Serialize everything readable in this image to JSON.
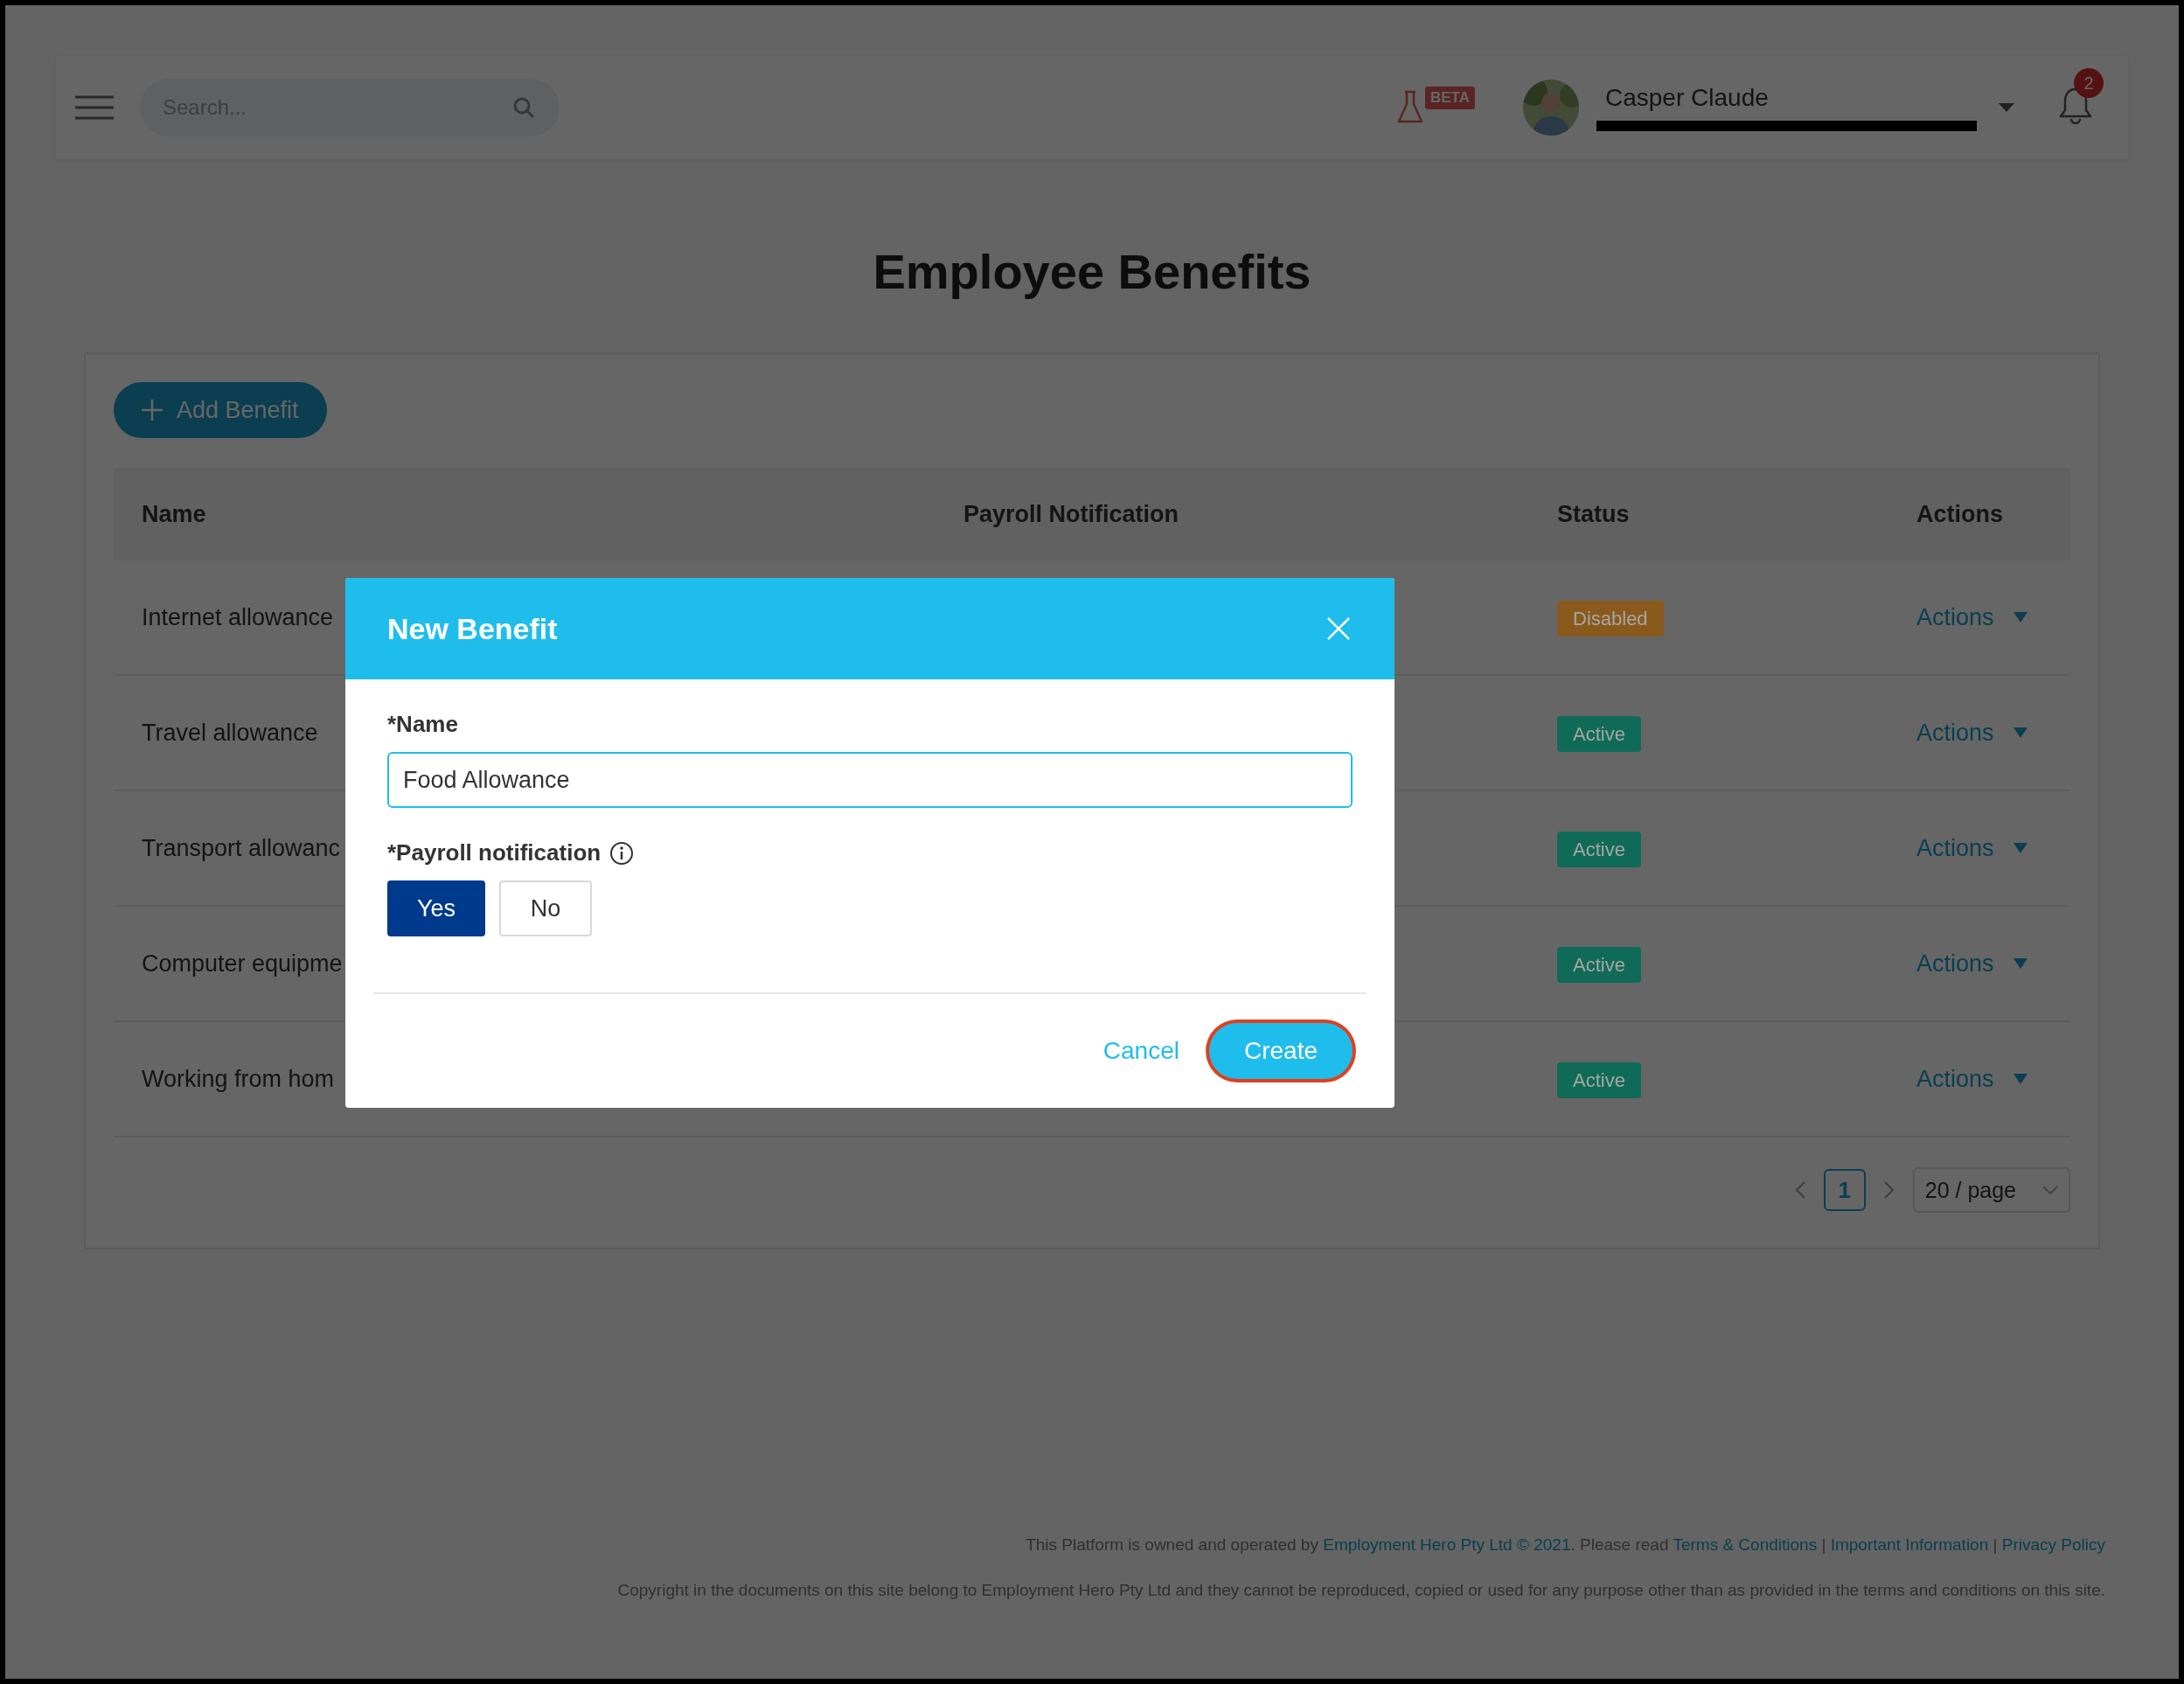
{
  "header": {
    "search": {
      "placeholder": "Search..."
    },
    "beta_badge": "BETA",
    "user": {
      "name": "Casper Claude"
    },
    "notifications": {
      "count": "2"
    }
  },
  "page_title": "Employee Benefits",
  "add_button": "Add Benefit",
  "table": {
    "columns": [
      "Name",
      "Payroll Notification",
      "Status",
      "Actions"
    ],
    "rows": [
      {
        "name": "Internet allowance",
        "status": {
          "label": "Disabled",
          "color": "#8a5a1c"
        },
        "actions": "Actions"
      },
      {
        "name": "Travel allowance",
        "status": {
          "label": "Active",
          "color": "#0f6b57"
        },
        "actions": "Actions"
      },
      {
        "name": "Transport allowanc",
        "status": {
          "label": "Active",
          "color": "#0f6b57"
        },
        "actions": "Actions"
      },
      {
        "name": "Computer equipme",
        "status": {
          "label": "Active",
          "color": "#0f6b57"
        },
        "actions": "Actions"
      },
      {
        "name": "Working from hom",
        "status": {
          "label": "Active",
          "color": "#0f6b57"
        },
        "actions": "Actions"
      }
    ]
  },
  "pagination": {
    "pages": [
      {
        "label": "1",
        "selected": true
      }
    ],
    "page_size": "20 / page"
  },
  "modal": {
    "title": "New Benefit",
    "name_field": {
      "label": "*Name",
      "value": "Food Allowance"
    },
    "payroll": {
      "label": "*Payroll notification",
      "options": [
        {
          "label": "Yes",
          "selected": true
        },
        {
          "label": "No",
          "selected": false
        }
      ]
    },
    "buttons": [
      {
        "label": "Cancel",
        "kind": "link",
        "highlighted": false
      },
      {
        "label": "Create",
        "kind": "primary",
        "highlighted": true
      }
    ]
  },
  "footer": {
    "line_1": [
      {
        "kind": "text",
        "text": "This Platform is owned and operated by "
      },
      {
        "kind": "link",
        "text": "Employment Hero Pty Ltd © 2021"
      },
      {
        "kind": "text",
        "text": ". Please read "
      },
      {
        "kind": "link",
        "text": "Terms & Conditions"
      },
      {
        "kind": "text",
        "text": " | "
      },
      {
        "kind": "link",
        "text": "Important Information"
      },
      {
        "kind": "text",
        "text": " | "
      },
      {
        "kind": "link",
        "text": "Privacy Policy"
      }
    ],
    "line_2": "Copyright in the documents on this site belong to Employment Hero Pty Ltd and they cannot be reproduced, copied or used for any purpose other than as provided in the terms and conditions on this site."
  }
}
